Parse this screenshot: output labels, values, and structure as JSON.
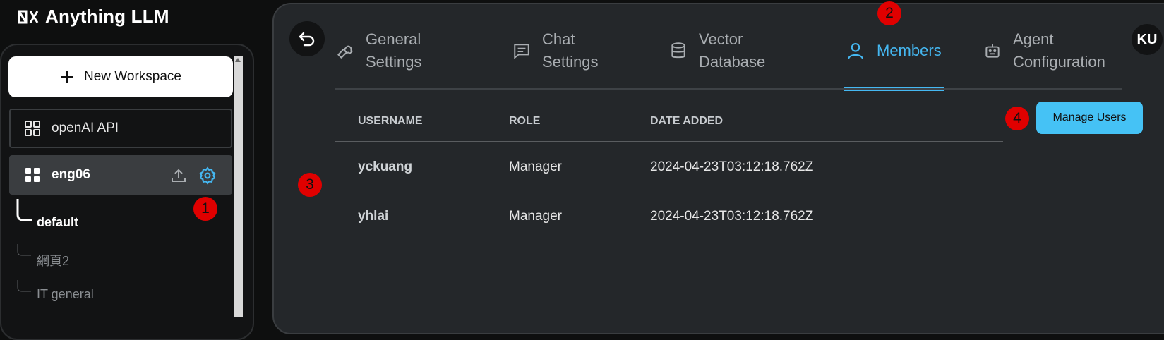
{
  "app": {
    "name": "Anything LLM"
  },
  "sidebar": {
    "new_workspace_label": "New Workspace",
    "workspaces": [
      {
        "name": "openAI API"
      },
      {
        "name": "eng06"
      }
    ],
    "threads": [
      "default",
      "網頁2",
      "IT general"
    ]
  },
  "tabs": [
    {
      "label_line1": "General",
      "label_line2": "Settings"
    },
    {
      "label_line1": "Chat",
      "label_line2": "Settings"
    },
    {
      "label_line1": "Vector",
      "label_line2": "Database"
    },
    {
      "label": "Members"
    },
    {
      "label_line1": "Agent",
      "label_line2": "Configuration"
    }
  ],
  "user": {
    "initials": "KU"
  },
  "members_table": {
    "headers": [
      "USERNAME",
      "ROLE",
      "DATE ADDED"
    ],
    "rows": [
      {
        "username": "yckuang",
        "role": "Manager",
        "date_added": "2024-04-23T03:12:18.762Z"
      },
      {
        "username": "yhlai",
        "role": "Manager",
        "date_added": "2024-04-23T03:12:18.762Z"
      }
    ]
  },
  "manage_users_label": "Manage Users",
  "badges": [
    "1",
    "2",
    "3",
    "4"
  ],
  "colors": {
    "accent": "#45b8f2",
    "badge": "#e00000"
  }
}
